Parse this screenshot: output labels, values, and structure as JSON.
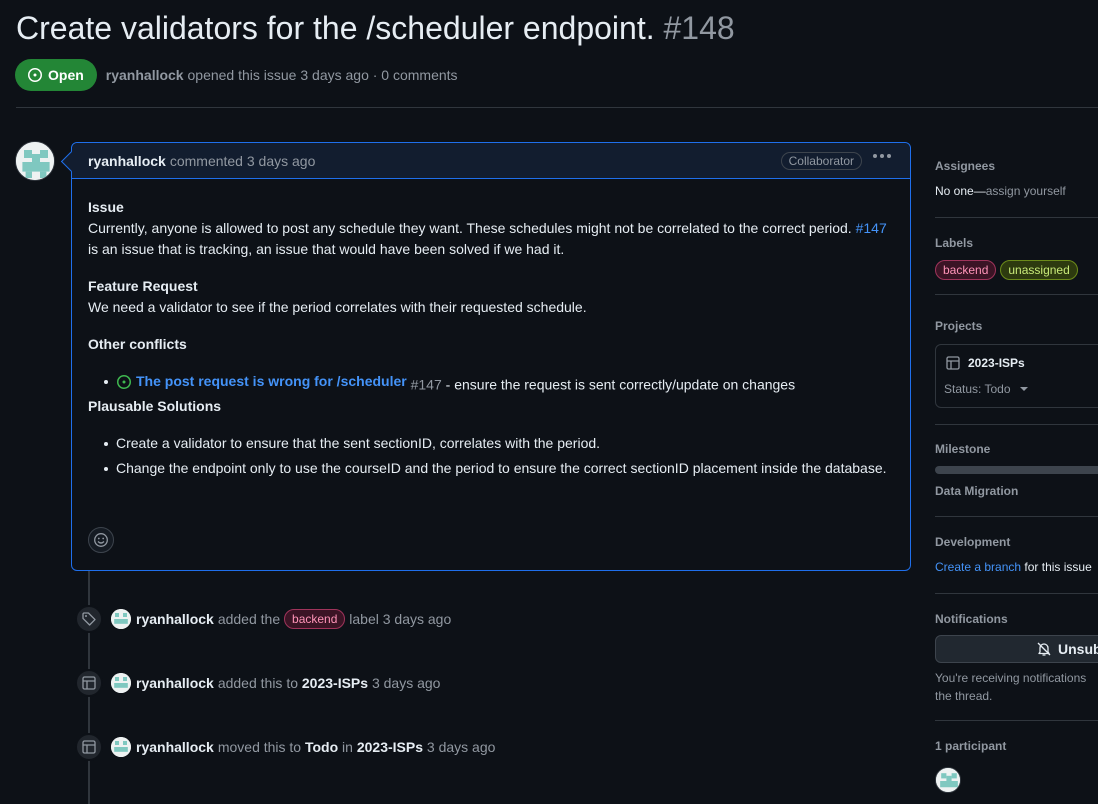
{
  "issue": {
    "title": "Create validators for the /scheduler endpoint.",
    "number": "#148",
    "state": "Open",
    "author": "ryanhallock",
    "meta": "opened this issue 3 days ago · 0 comments"
  },
  "comment": {
    "author": "ryanhallock",
    "when": "commented 3 days ago",
    "badge": "Collaborator",
    "issue_heading": "Issue",
    "issue_text_1": "Currently, anyone is allowed to post any schedule they want. These schedules might not be correlated to the correct period.",
    "issue_ref": "#147",
    "issue_text_2": "is an issue that is tracking, an issue that would have been solved if we had it.",
    "feature_heading": "Feature Request",
    "feature_text": "We need a validator to see if the period correlates with their requested schedule.",
    "conflicts_heading": "Other conflicts",
    "conflict_title": "The post request is wrong for /scheduler",
    "conflict_num": "#147",
    "conflict_rest": "- ensure the request is sent correctly/update on changes",
    "solutions_heading": "Plausable Solutions",
    "solutions": [
      "Create a validator to ensure that the sent sectionID, correlates with the period.",
      "Change the endpoint only to use the courseID and the period to ensure the correct sectionID placement inside the database."
    ]
  },
  "timeline": [
    {
      "who": "ryanhallock",
      "pre": "added the",
      "label": "backend",
      "post": "label 3 days ago"
    },
    {
      "who": "ryanhallock",
      "pre": "added this to",
      "project": "2023-ISPs",
      "post": "3 days ago"
    },
    {
      "who": "ryanhallock",
      "pre": "moved this to",
      "status": "Todo",
      "mid": "in",
      "project": "2023-ISPs",
      "post": "3 days ago"
    }
  ],
  "sidebar": {
    "assignees_title": "Assignees",
    "assignees_value": "No one—",
    "assign_link": "assign yourself",
    "labels_title": "Labels",
    "labels": [
      "backend",
      "unassigned"
    ],
    "projects_title": "Projects",
    "project_name": "2023-ISPs",
    "project_status": "Status: Todo",
    "milestone_title": "Milestone",
    "milestone_name": "Data Migration",
    "development_title": "Development",
    "dev_link": "Create a branch",
    "dev_text": "for this issue",
    "notifications_title": "Notifications",
    "unsub_label": "Unsubs",
    "notif_text": "You're receiving notifications",
    "notif_text_2": "the thread.",
    "participants_title": "1 participant"
  },
  "colors": {
    "open_green": "#238636",
    "accent_blue": "#4493f8",
    "label_backend": "#ff94b8",
    "label_unassigned": "#c8ea79"
  }
}
